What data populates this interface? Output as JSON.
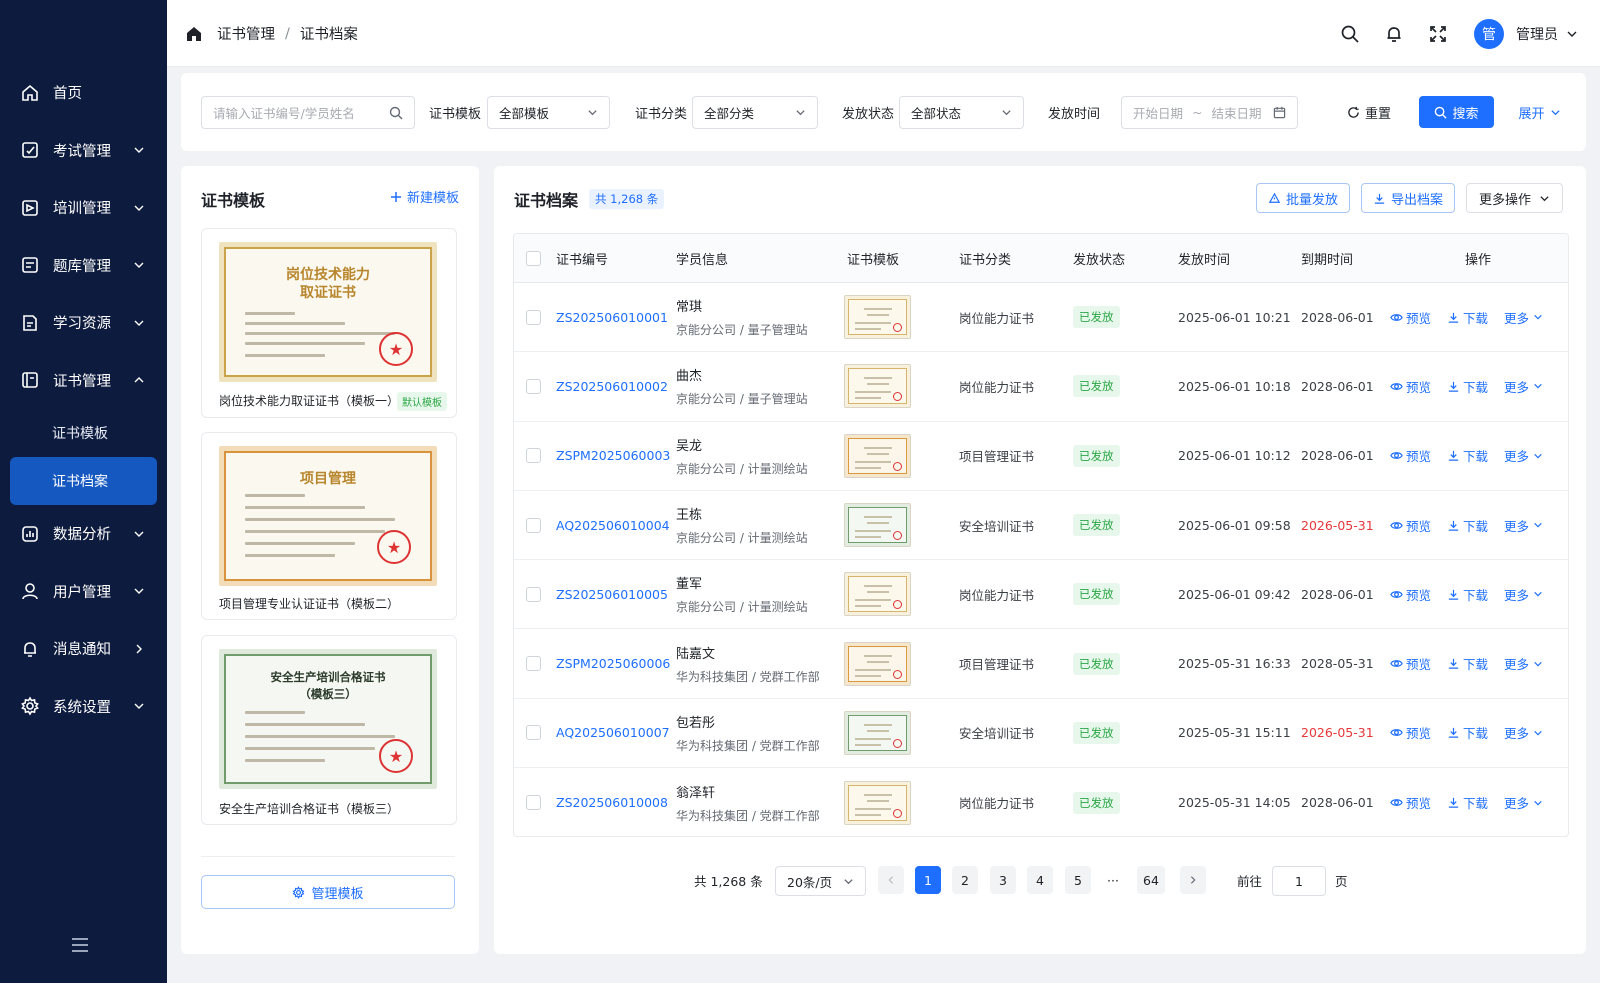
{
  "sidebar": {
    "items": [
      {
        "label": "首页",
        "icon": "home-icon"
      },
      {
        "label": "考试管理",
        "icon": "exam-icon"
      },
      {
        "label": "培训管理",
        "icon": "training-icon"
      },
      {
        "label": "题库管理",
        "icon": "question-bank-icon"
      },
      {
        "label": "学习资源",
        "icon": "resource-icon"
      },
      {
        "label": "证书管理",
        "icon": "certificate-icon"
      },
      {
        "label": "数据分析",
        "icon": "analytics-icon"
      },
      {
        "label": "用户管理",
        "icon": "user-icon"
      },
      {
        "label": "消息通知",
        "icon": "bell-icon"
      },
      {
        "label": "系统设置",
        "icon": "gear-icon"
      }
    ],
    "sub_items": [
      "证书模板",
      "证书档案"
    ]
  },
  "header": {
    "breadcrumb": [
      "证书管理",
      "证书档案"
    ],
    "avatar_text": "管",
    "user_name": "管理员"
  },
  "filter": {
    "search_placeholder": "请输入证书编号/学员姓名",
    "template_label": "证书模板",
    "template_value": "全部模板",
    "category_label": "证书分类",
    "category_value": "全部分类",
    "status_label": "发放状态",
    "status_value": "全部状态",
    "time_label": "发放时间",
    "start_placeholder": "开始日期",
    "range_sep": "~",
    "end_placeholder": "结束日期",
    "reset": "重置",
    "search": "搜索",
    "expand": "展开"
  },
  "templates": {
    "title": "证书模板",
    "new_button": "新建模板",
    "items": [
      {
        "name": "岗位技术能力取证证书（模板一）",
        "cert_title_1": "岗位技术能力",
        "cert_title_2": "取证证书",
        "tag": "默认模板"
      },
      {
        "name": "项目管理专业认证证书（模板二）",
        "cert_title_1": "项目管理",
        "cert_title_2": ""
      },
      {
        "name": "安全生产培训合格证书（模板三）",
        "cert_title_1": "安全生产培训合格证书",
        "cert_title_2": "（模板三）"
      }
    ],
    "manage_button": "管理模板"
  },
  "archive": {
    "title": "证书档案",
    "count": "共 1,268 条",
    "batch_issue": "批量发放",
    "export": "导出档案",
    "more_ops": "更多操作",
    "columns": [
      "证书编号",
      "学员信息",
      "证书模板",
      "证书分类",
      "发放状态",
      "发放时间",
      "到期时间",
      "操作"
    ],
    "actions": {
      "preview": "预览",
      "download": "下载",
      "more": "更多"
    },
    "rows": [
      {
        "code": "ZS202506010001",
        "name": "常琪",
        "org": "京能分公司 / 量子管理站",
        "tpl": "gold",
        "category": "岗位能力证书",
        "status": "已发放",
        "issued": "2025-06-01 10:21",
        "expires": "2028-06-01",
        "expired_soon": false
      },
      {
        "code": "ZS202506010002",
        "name": "曲杰",
        "org": "京能分公司 / 量子管理站",
        "tpl": "gold",
        "category": "岗位能力证书",
        "status": "已发放",
        "issued": "2025-06-01 10:18",
        "expires": "2028-06-01",
        "expired_soon": false
      },
      {
        "code": "ZSPM2025060003",
        "name": "吴龙",
        "org": "京能分公司 / 计量测绘站",
        "tpl": "orange",
        "category": "项目管理证书",
        "status": "已发放",
        "issued": "2025-06-01 10:12",
        "expires": "2028-06-01",
        "expired_soon": false
      },
      {
        "code": "AQ202506010004",
        "name": "王栋",
        "org": "京能分公司 / 计量测绘站",
        "tpl": "green",
        "category": "安全培训证书",
        "status": "已发放",
        "issued": "2025-06-01 09:58",
        "expires": "2026-05-31",
        "expired_soon": true
      },
      {
        "code": "ZS202506010005",
        "name": "董军",
        "org": "京能分公司 / 计量测绘站",
        "tpl": "gold",
        "category": "岗位能力证书",
        "status": "已发放",
        "issued": "2025-06-01 09:42",
        "expires": "2028-06-01",
        "expired_soon": false
      },
      {
        "code": "ZSPM2025060006",
        "name": "陆嘉文",
        "org": "华为科技集团 / 党群工作部",
        "tpl": "orange",
        "category": "项目管理证书",
        "status": "已发放",
        "issued": "2025-05-31 16:33",
        "expires": "2028-05-31",
        "expired_soon": false
      },
      {
        "code": "AQ202506010007",
        "name": "包若彤",
        "org": "华为科技集团 / 党群工作部",
        "tpl": "green",
        "category": "安全培训证书",
        "status": "已发放",
        "issued": "2025-05-31 15:11",
        "expires": "2026-05-31",
        "expired_soon": true
      },
      {
        "code": "ZS202506010008",
        "name": "翁泽轩",
        "org": "华为科技集团 / 党群工作部",
        "tpl": "gold",
        "category": "岗位能力证书",
        "status": "已发放",
        "issued": "2025-05-31 14:05",
        "expires": "2028-06-01",
        "expired_soon": false
      }
    ]
  },
  "pagination": {
    "total": "共 1,268 条",
    "page_size": "20条/页",
    "pages": [
      "1",
      "2",
      "3",
      "4",
      "5"
    ],
    "ellipsis": "···",
    "last": "64",
    "current": "1",
    "goto_label": "前往",
    "goto_value": "1",
    "goto_unit": "页"
  },
  "colors": {
    "sidebar_bg": "#0d1b3e",
    "primary": "#1e6fff",
    "success": "#2aa745",
    "danger": "#e5383b"
  }
}
